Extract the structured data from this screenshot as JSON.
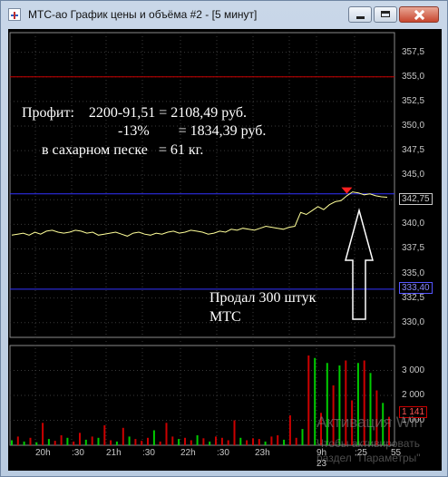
{
  "window": {
    "title": "МТС-ао График цены и объёма #2 - [5 минут]",
    "icon": "chart-app-icon"
  },
  "price_axis": {
    "ticks": [
      "357,5",
      "355,0",
      "352,5",
      "350,0",
      "347,5",
      "345,0",
      "342,5",
      "340,0",
      "337,5",
      "335,0",
      "332,5",
      "330,0"
    ],
    "current_price": "342,75",
    "level_marker": "333,40"
  },
  "volume_axis": {
    "ticks": [
      "3 000",
      "2 000",
      "1 000"
    ],
    "current_volume": "1 141"
  },
  "time_axis": {
    "labels": [
      "20h",
      ":30",
      "21h",
      ":30",
      "22h",
      ":30",
      "23h",
      "9h",
      ":25",
      "55"
    ],
    "date_label": "23"
  },
  "annotations": {
    "line1": "Профит:    2200-91,51 = 2108,49 руб.",
    "line2": "-13%        = 1834,39 руб.",
    "line3": "в сахарном песке   = 61 кг.",
    "sold_line1": "Продал 300 штук",
    "sold_line2": "МТС"
  },
  "watermark": {
    "title": "Активация Win",
    "line1": "Чтобы активировать",
    "line2": "раздел \"Параметры\""
  },
  "colors": {
    "background": "#000000",
    "price_line": "#ffff99",
    "red_level": "#cc0000",
    "blue_level": "#3333ff",
    "volume_up": "#00cc00",
    "volume_down": "#cc0000",
    "grid": "#3a3a3a"
  },
  "chart_data": [
    {
      "type": "line",
      "title": "",
      "series": [
        {
          "values": [
            338.9,
            339.0,
            339.1,
            338.9,
            339.2,
            339.0,
            339.3,
            339.4,
            339.2,
            339.1,
            339.2,
            339.4,
            339.3,
            339.1,
            339.2,
            338.9,
            339.0,
            339.1,
            339.2,
            339.0,
            338.8,
            339.1,
            339.2,
            339.0,
            338.9,
            339.1,
            339.0,
            339.2,
            339.3,
            339.1,
            339.2,
            339.4,
            339.3,
            339.2,
            339.0,
            339.1,
            339.3,
            339.2,
            339.5,
            339.4,
            339.6,
            339.5,
            339.4,
            339.6,
            339.8,
            339.7,
            339.6,
            339.5,
            339.7,
            339.8,
            341.2,
            341.0,
            341.4,
            341.8,
            341.5,
            342.0,
            342.3,
            342.4,
            342.9,
            343.3,
            343.2,
            343.0,
            343.1,
            342.9,
            342.8,
            342.75
          ]
        }
      ],
      "ylim": [
        328.5,
        359.5
      ],
      "horizontal_lines": [
        355.0,
        343.1,
        333.4
      ],
      "marker_at": 343.3
    },
    {
      "type": "bar",
      "title": "",
      "values": [
        200,
        350,
        150,
        300,
        120,
        900,
        250,
        180,
        400,
        300,
        150,
        500,
        220,
        350,
        300,
        800,
        200,
        150,
        700,
        350,
        250,
        180,
        300,
        600,
        150,
        900,
        350,
        250,
        300,
        200,
        400,
        280,
        150,
        350,
        300,
        200,
        1000,
        300,
        200,
        280,
        250,
        150,
        350,
        400,
        220,
        1200,
        300,
        650,
        3600,
        3500,
        1300,
        3300,
        2400,
        3200,
        3400,
        1800,
        3300,
        3400,
        2900,
        2200,
        1700,
        1141
      ],
      "up": [
        true,
        false,
        true,
        false,
        true,
        false,
        true,
        false,
        false,
        true,
        false,
        false,
        true,
        false,
        true,
        false,
        false,
        true,
        false,
        true,
        false,
        false,
        false,
        true,
        false,
        false,
        false,
        true,
        false,
        false,
        true,
        false,
        true,
        false,
        false,
        false,
        false,
        true,
        false,
        false,
        false,
        true,
        false,
        false,
        true,
        false,
        false,
        true,
        false,
        true,
        false,
        true,
        false,
        true,
        false,
        false,
        true,
        false,
        true,
        false,
        true,
        false
      ],
      "ylim": [
        0,
        4000
      ]
    }
  ]
}
